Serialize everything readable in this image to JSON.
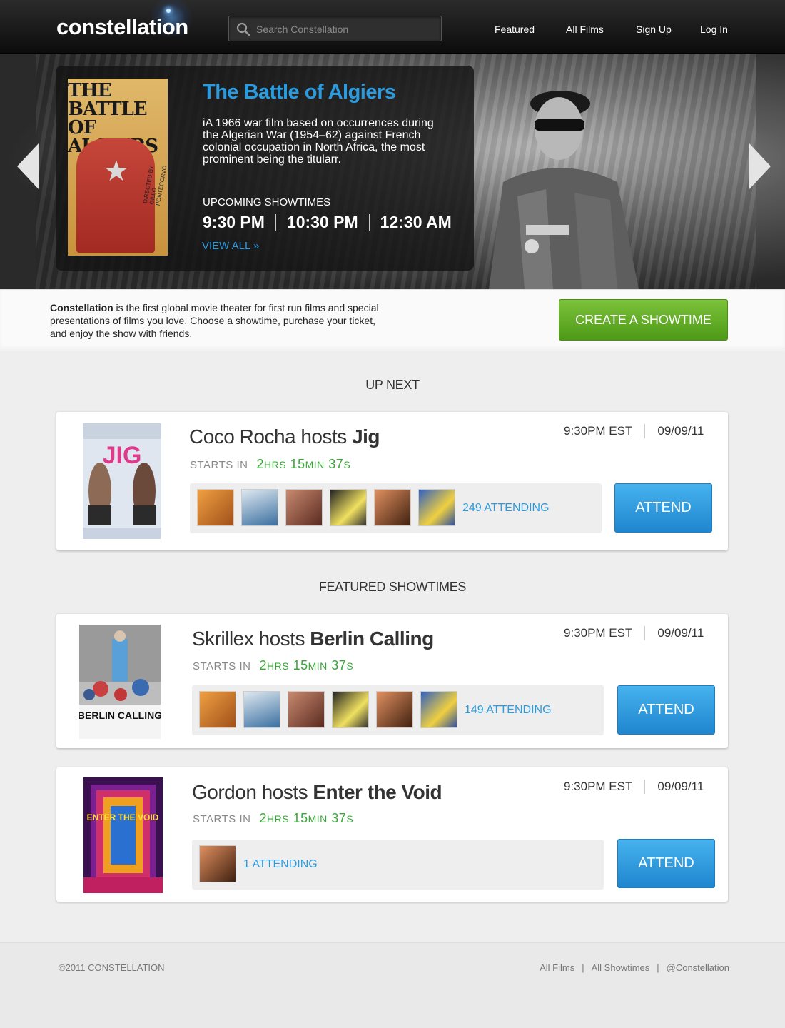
{
  "brand": {
    "logo": "constellation"
  },
  "search": {
    "placeholder": "Search Constellation"
  },
  "nav": [
    {
      "label": "Featured"
    },
    {
      "label": "All Films"
    },
    {
      "label": "Sign Up"
    },
    {
      "label": "Log In"
    }
  ],
  "hero": {
    "poster_title": "THE BATTLE OF ALGIERS",
    "poster_credit": "DIRECTED BY GILLO PONTECORVO",
    "title": "The Battle of Algiers",
    "description": "iA 1966 war film based on occurrences during the Algerian War (1954–62) against French colonial occupation in North Africa, the most prominent being the titularr.",
    "upcoming_label": "UPCOMING SHOWTIMES",
    "showtimes": [
      "9:30 PM",
      "10:30 PM",
      "12:30 AM"
    ],
    "view_all": "VIEW ALL »"
  },
  "intro": {
    "brand": "Constellation",
    "text": " is the first global movie theater for first run films and special presentations of films you love. Choose a showtime, purchase your ticket, and enjoy the show with friends.",
    "create_button": "CREATE A SHOWTIME"
  },
  "up_next": {
    "heading": "UP NEXT",
    "card": {
      "poster_title": "JIG",
      "host": "Coco Rocha hosts ",
      "film": "Jig",
      "starts_label": "STARTS IN",
      "hrs": "2",
      "hrs_unit": "hrs",
      "min": "15",
      "min_unit": "min",
      "sec": "37",
      "sec_unit": "s",
      "time": "9:30PM EST",
      "date": "09/09/11",
      "attending": "249 ATTENDING",
      "attend_label": "ATTEND"
    }
  },
  "featured": {
    "heading": "FEATURED SHOWTIMES",
    "cards": [
      {
        "poster_title": "BERLIN CALLING",
        "host": "Skrillex hosts ",
        "film": "Berlin Calling",
        "starts_label": "STARTS IN",
        "hrs": "2",
        "hrs_unit": "hrs",
        "min": "15",
        "min_unit": "min",
        "sec": "37",
        "sec_unit": "s",
        "time": "9:30PM EST",
        "date": "09/09/11",
        "attending": "149 ATTENDING",
        "attend_label": "ATTEND"
      },
      {
        "poster_title": "ENTER THE VOID",
        "host": "Gordon hosts ",
        "film": "Enter the Void",
        "starts_label": "STARTS IN",
        "hrs": "2",
        "hrs_unit": "hrs",
        "min": "15",
        "min_unit": "min",
        "sec": "37",
        "sec_unit": "s",
        "time": "9:30PM EST",
        "date": "09/09/11",
        "attending": "1 ATTENDING",
        "attend_label": "ATTEND"
      }
    ]
  },
  "footer": {
    "copyright": "©2011 CONSTELLATION",
    "links": [
      "All Films",
      "All Showtimes",
      "@Constellation"
    ]
  },
  "colors": {
    "accent_blue": "#2b9be0",
    "create_green": "#5aa821",
    "countdown_green": "#3aa63a"
  }
}
